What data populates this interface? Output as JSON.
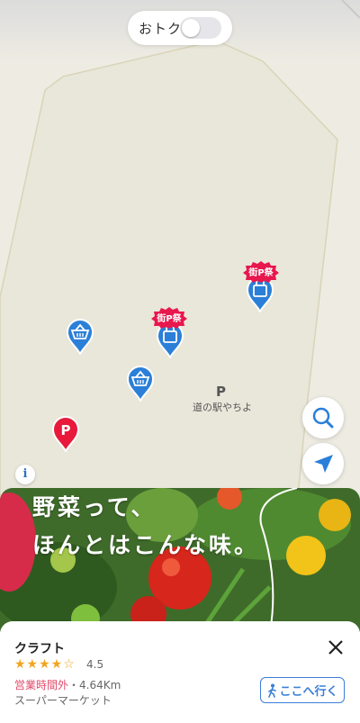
{
  "map": {
    "toggle_label": "おトク",
    "toggle_on": false,
    "badge_text": "街P祭",
    "parking_mark": "P",
    "place_name": "道の駅やちよ",
    "info_label": "i"
  },
  "banner": {
    "line1": "野菜って、",
    "line2": "ほんとはこんな味。"
  },
  "shop": {
    "name": "クラフト",
    "stars": "★★★★☆",
    "rating": "4.5",
    "hours_status": "営業時間外",
    "distance": "・4.64Km",
    "category": "スーパーマーケット",
    "go_button": "ここへ行く"
  },
  "colors": {
    "pin_blue": "#2b7fd8",
    "pin_red": "#e8193a",
    "badge_pink": "#e8174d",
    "hours_red": "#e04a6a",
    "star_gold": "#f1a51e"
  }
}
